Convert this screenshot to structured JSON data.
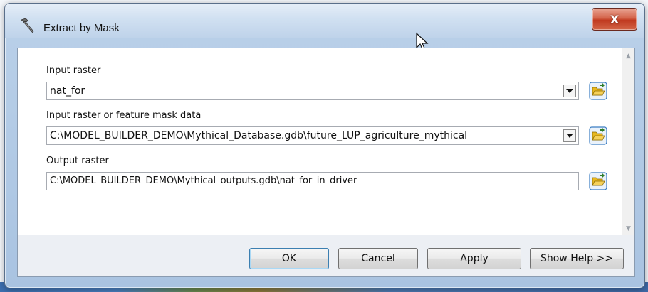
{
  "window": {
    "title": "Extract by Mask",
    "close_label": "X"
  },
  "form": {
    "input_raster": {
      "label": "Input raster",
      "value": "nat_for"
    },
    "mask_data": {
      "label": "Input raster or feature mask data",
      "value": "C:\\MODEL_BUILDER_DEMO\\Mythical_Database.gdb\\future_LUP_agriculture_mythical"
    },
    "output_raster": {
      "label": "Output raster",
      "value": "C:\\MODEL_BUILDER_DEMO\\Mythical_outputs.gdb\\nat_for_in_driver"
    }
  },
  "buttons": {
    "ok": "OK",
    "cancel": "Cancel",
    "apply": "Apply",
    "help": "Show Help >>"
  },
  "icons": {
    "title": "hammer-icon",
    "browse": "open-folder-icon",
    "cursor": "mouse-pointer-icon"
  },
  "colors": {
    "close_button": "#c0391f",
    "folder_icon": "#e8b820",
    "title_bar": "#d0e0f1"
  }
}
